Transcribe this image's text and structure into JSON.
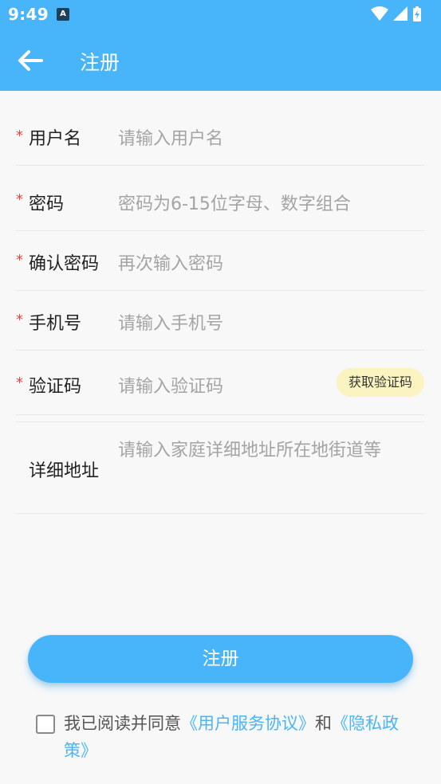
{
  "status_bar": {
    "time": "9:49",
    "notification_icon": "A"
  },
  "header": {
    "title": "注册",
    "back_icon": "arrow-left-icon",
    "bg_color": "#48b5fb"
  },
  "form": {
    "required_mark": "*",
    "username": {
      "label": "用户名",
      "placeholder": "请输入用户名",
      "required": true
    },
    "password": {
      "label": "密码",
      "placeholder": "密码为6-15位字母、数字组合",
      "required": true
    },
    "confirm_password": {
      "label": "确认密码",
      "placeholder": "再次输入密码",
      "required": true
    },
    "phone": {
      "label": "手机号",
      "placeholder": "请输入手机号",
      "required": true
    },
    "verify_code": {
      "label": "验证码",
      "placeholder": "请输入验证码",
      "required": true,
      "button_label": "获取验证码"
    },
    "address": {
      "label": "详细地址",
      "placeholder": "请输入家庭详细地址所在地街道等",
      "required": false
    }
  },
  "submit_label": "注册",
  "agreement": {
    "checked": false,
    "prefix": "我已阅读并同意",
    "service_link": "《用户服务协议》",
    "conjunction": "和",
    "privacy_link": "《隐私政策》"
  },
  "colors": {
    "accent": "#48b5fb",
    "required": "#e0483e",
    "code_button_bg": "#fbf4c0"
  }
}
